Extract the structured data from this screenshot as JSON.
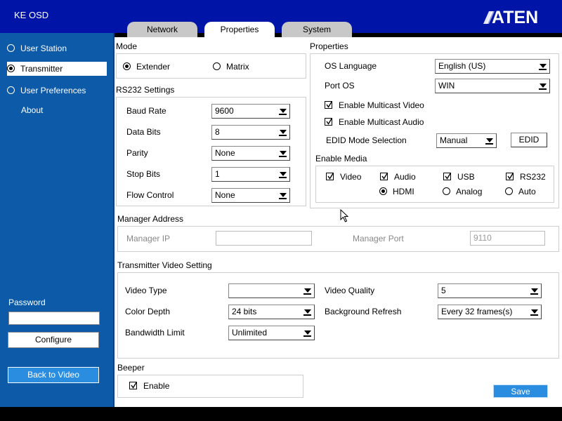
{
  "app": {
    "title": "KE OSD",
    "logo_text": "ATEN"
  },
  "tabs": [
    {
      "label": "Network",
      "active": false
    },
    {
      "label": "Properties",
      "active": true
    },
    {
      "label": "System",
      "active": false
    }
  ],
  "sidebar": {
    "items": [
      {
        "label": "User Station",
        "selected": false,
        "has_radio": true
      },
      {
        "label": "Transmitter",
        "selected": true,
        "has_radio": true
      },
      {
        "label": "User Preferences",
        "selected": false,
        "has_radio": true
      },
      {
        "label": "About",
        "selected": false,
        "has_radio": false
      }
    ],
    "password_label": "Password",
    "password_value": "",
    "configure_label": "Configure",
    "back_label": "Back to Video"
  },
  "mode": {
    "title": "Mode",
    "options": [
      {
        "label": "Extender",
        "selected": true
      },
      {
        "label": "Matrix",
        "selected": false
      }
    ]
  },
  "rs232": {
    "title": "RS232 Settings",
    "fields": [
      {
        "label": "Baud Rate",
        "value": "9600"
      },
      {
        "label": "Data Bits",
        "value": "8"
      },
      {
        "label": "Parity",
        "value": "None"
      },
      {
        "label": "Stop Bits",
        "value": "1"
      },
      {
        "label": "Flow Control",
        "value": "None"
      }
    ]
  },
  "properties": {
    "title": "Properties",
    "os_language_label": "OS Language",
    "os_language_value": "English (US)",
    "port_os_label": "Port OS",
    "port_os_value": "WIN",
    "multicast_video": {
      "label": "Enable Multicast Video",
      "checked": true
    },
    "multicast_audio": {
      "label": "Enable Multicast Audio",
      "checked": true
    },
    "edid_label": "EDID Mode Selection",
    "edid_value": "Manual",
    "edid_button": "EDID",
    "enable_media_title": "Enable Media",
    "media": [
      {
        "label": "Video",
        "checked": true
      },
      {
        "label": "Audio",
        "checked": true
      },
      {
        "label": "USB",
        "checked": true
      },
      {
        "label": "RS232",
        "checked": true
      }
    ],
    "audio_source": [
      {
        "label": "HDMI",
        "selected": true
      },
      {
        "label": "Analog",
        "selected": false
      },
      {
        "label": "Auto",
        "selected": false
      }
    ]
  },
  "manager": {
    "title": "Manager Address",
    "ip_label": "Manager IP",
    "ip_value": "",
    "port_label": "Manager Port",
    "port_value": "9110"
  },
  "video_setting": {
    "title": "Transmitter Video Setting",
    "video_type_label": "Video Type",
    "video_type_value": "",
    "color_depth_label": "Color Depth",
    "color_depth_value": "24 bits",
    "bandwidth_label": "Bandwidth Limit",
    "bandwidth_value": "Unlimited",
    "quality_label": "Video Quality",
    "quality_value": "5",
    "refresh_label": "Background Refresh",
    "refresh_value": "Every 32 frames(s)"
  },
  "beeper": {
    "title": "Beeper",
    "enable_label": "Enable",
    "checked": true
  },
  "footer": {
    "save_label": "Save"
  },
  "colors": {
    "header": "#0015a8",
    "sidebar": "#0d5aa8",
    "accent_button": "#2b8de0"
  }
}
